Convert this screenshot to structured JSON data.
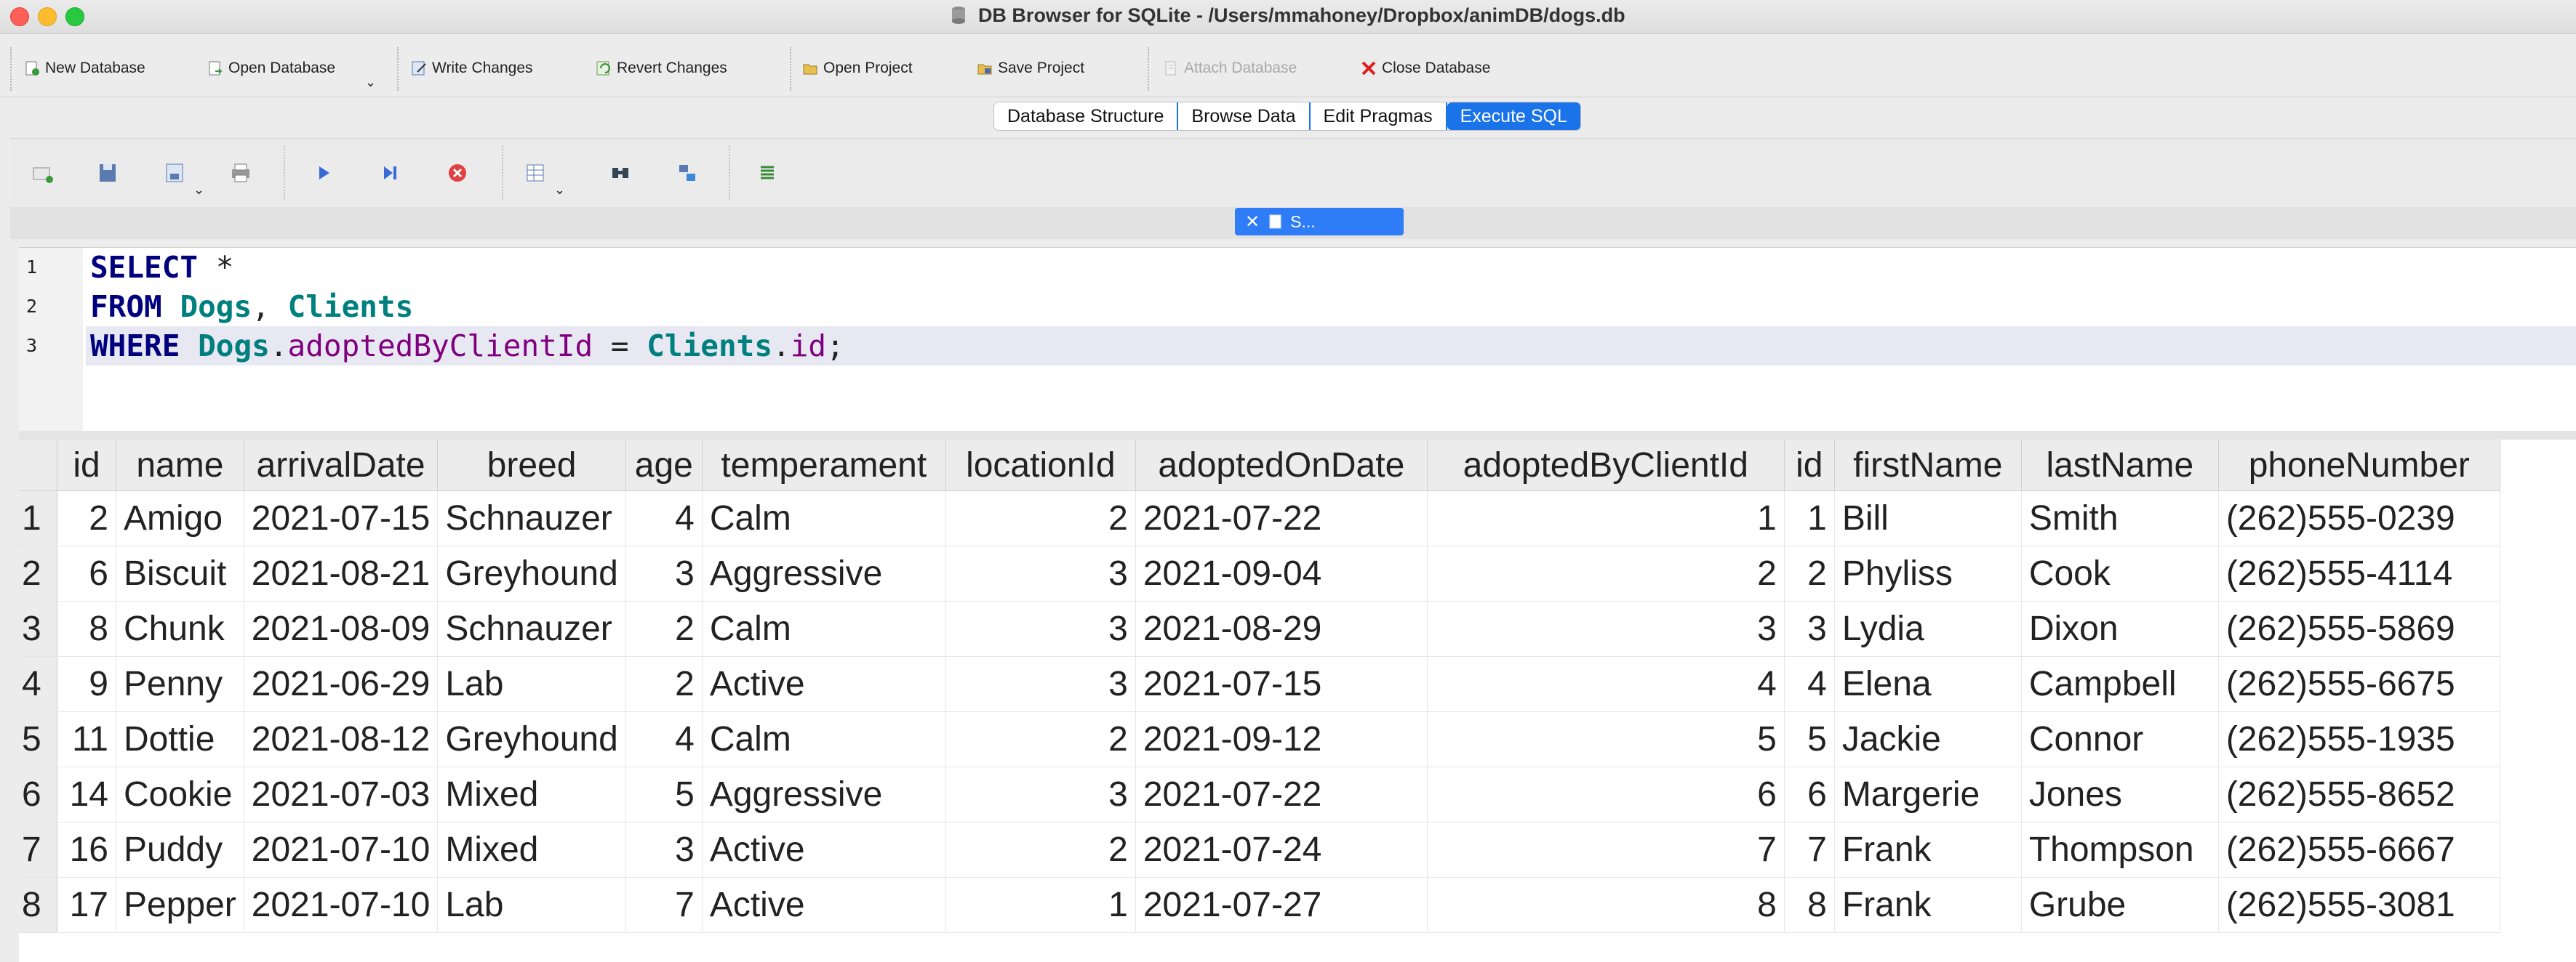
{
  "window": {
    "title": "DB Browser for SQLite - /Users/mmahoney/Dropbox/animDB/dogs.db"
  },
  "toolbar": {
    "new_database": "New Database",
    "open_database": "Open Database",
    "write_changes": "Write Changes",
    "revert_changes": "Revert Changes",
    "open_project": "Open Project",
    "save_project": "Save Project",
    "attach_database": "Attach Database",
    "close_database": "Close Database"
  },
  "tabs": [
    "Database Structure",
    "Browse Data",
    "Edit Pragmas",
    "Execute SQL"
  ],
  "active_tab": "Execute SQL",
  "editor_tab": {
    "label": "S..."
  },
  "sql": {
    "line_numbers": [
      "1",
      "2",
      "3"
    ],
    "l1_kw": "SELECT",
    "l1_rest": " *",
    "l2_kw": "FROM",
    "l2_t1": "Dogs",
    "l2_sep": ", ",
    "l2_t2": "Clients",
    "l3_kw": "WHERE",
    "l3_t1": "Dogs",
    "l3_dot1": ".",
    "l3_c1": "adoptedByClientId",
    "l3_eq": " = ",
    "l3_t2": "Clients",
    "l3_dot2": ".",
    "l3_c2": "id",
    "l3_end": ";"
  },
  "results": {
    "columns": [
      "id",
      "name",
      "arrivalDate",
      "breed",
      "age",
      "temperament",
      "locationId",
      "adoptedOnDate",
      "adoptedByClientId",
      "id",
      "firstName",
      "lastName",
      "phoneNumber"
    ],
    "rows": [
      [
        "1",
        "2",
        "Amigo",
        "2021-07-15",
        "Schnauzer",
        "4",
        "Calm",
        "2",
        "2021-07-22",
        "1",
        "1",
        "Bill",
        "Smith",
        "(262)555-0239"
      ],
      [
        "2",
        "6",
        "Biscuit",
        "2021-08-21",
        "Greyhound",
        "3",
        "Aggressive",
        "3",
        "2021-09-04",
        "2",
        "2",
        "Phyliss",
        "Cook",
        "(262)555-4114"
      ],
      [
        "3",
        "8",
        "Chunk",
        "2021-08-09",
        "Schnauzer",
        "2",
        "Calm",
        "3",
        "2021-08-29",
        "3",
        "3",
        "Lydia",
        "Dixon",
        "(262)555-5869"
      ],
      [
        "4",
        "9",
        "Penny",
        "2021-06-29",
        "Lab",
        "2",
        "Active",
        "3",
        "2021-07-15",
        "4",
        "4",
        "Elena",
        "Campbell",
        "(262)555-6675"
      ],
      [
        "5",
        "11",
        "Dottie",
        "2021-08-12",
        "Greyhound",
        "4",
        "Calm",
        "2",
        "2021-09-12",
        "5",
        "5",
        "Jackie",
        "Connor",
        "(262)555-1935"
      ],
      [
        "6",
        "14",
        "Cookie",
        "2021-07-03",
        "Mixed",
        "5",
        "Aggressive",
        "3",
        "2021-07-22",
        "6",
        "6",
        "Margerie",
        "Jones",
        "(262)555-8652"
      ],
      [
        "7",
        "16",
        "Puddy",
        "2021-07-10",
        "Mixed",
        "3",
        "Active",
        "2",
        "2021-07-24",
        "7",
        "7",
        "Frank",
        "Thompson",
        "(262)555-6667"
      ],
      [
        "8",
        "17",
        "Pepper",
        "2021-07-10",
        "Lab",
        "7",
        "Active",
        "1",
        "2021-07-27",
        "8",
        "8",
        "Frank",
        "Grube",
        "(262)555-3081"
      ]
    ]
  },
  "colors": {
    "accent": "#1a73e8",
    "keyword": "#00007f",
    "table": "#007f7f",
    "column": "#7f007f",
    "close_red": "#e02020"
  }
}
